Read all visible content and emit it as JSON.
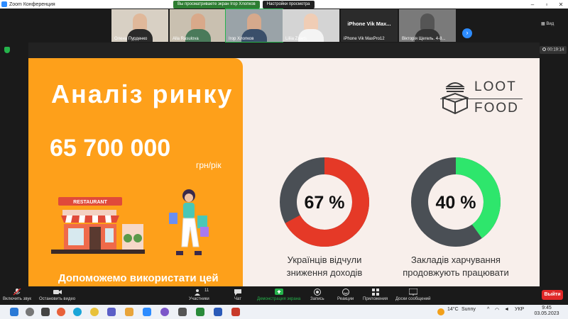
{
  "window": {
    "title": "Zoom Конференция"
  },
  "banner": {
    "viewing": "Вы просматриваете экран Ігор Хлопков",
    "view_options": "Настройки просмотра"
  },
  "gallery": {
    "participants": [
      {
        "name": "Олена Пурденко",
        "face": "#e0b89a",
        "shirt": "#2a2a2a",
        "bg": "#d8d0c4"
      },
      {
        "name": "Alla Rasulova",
        "face": "#d9a98a",
        "shirt": "#4a7a5a",
        "bg": "#c9c0b0"
      },
      {
        "name": "Ігор Хлопков",
        "face": "#d6a98c",
        "shirt": "#3a4f6a",
        "bg": "#9aa3a8"
      },
      {
        "name": "Liliia Zaiets",
        "face": "#f0cdb5",
        "shirt": "#f4f4f4",
        "bg": "#d4d4d4"
      },
      {
        "name": "iPhone Vik MaxPro12",
        "big": "iPhone  Vik  Max..."
      },
      {
        "name": "Вікторія Щегель. 4-8...",
        "face": "#555",
        "shirt": "#333",
        "bg": "#7a7a7a"
      }
    ],
    "view_label": "Вид"
  },
  "meeting": {
    "timer": "00:19:14"
  },
  "slide": {
    "title": "Аналіз ринку",
    "amount": "65 700 000",
    "unit": "грн/рік",
    "cta": "Допоможемо використати цей",
    "logo_top": "LOOT",
    "logo_bottom": "FOOD",
    "restaurant_sign": "RESTAURANT",
    "donuts": [
      {
        "label": "67 %",
        "value": 67,
        "color": "#e53927",
        "caption_lines": [
          "Українців відчули",
          "зниження доходів"
        ]
      },
      {
        "label": "40 %",
        "value": 40,
        "color": "#2ee66c",
        "caption_lines": [
          "Закладів харчування",
          "продовжують працювати"
        ]
      }
    ],
    "colors": {
      "orange": "#fea01a",
      "cream": "#f8efeb",
      "ring_dark": "#4a4f55"
    }
  },
  "toolbar": {
    "unmute": "Включить звук",
    "stop_video": "Остановить видео",
    "participants": "Участники",
    "participants_count": "11",
    "chat": "Чат",
    "share_screen": "Демонстрация экрана",
    "record": "Запись",
    "reactions": "Реакции",
    "apps": "Приложения",
    "whiteboards": "Доски сообщений",
    "leave": "Выйти"
  },
  "taskbar": {
    "weather_temp": "14°C",
    "weather_text": "Sunny",
    "language": "УКР",
    "time": "9:45",
    "date": "03.05.2023"
  }
}
